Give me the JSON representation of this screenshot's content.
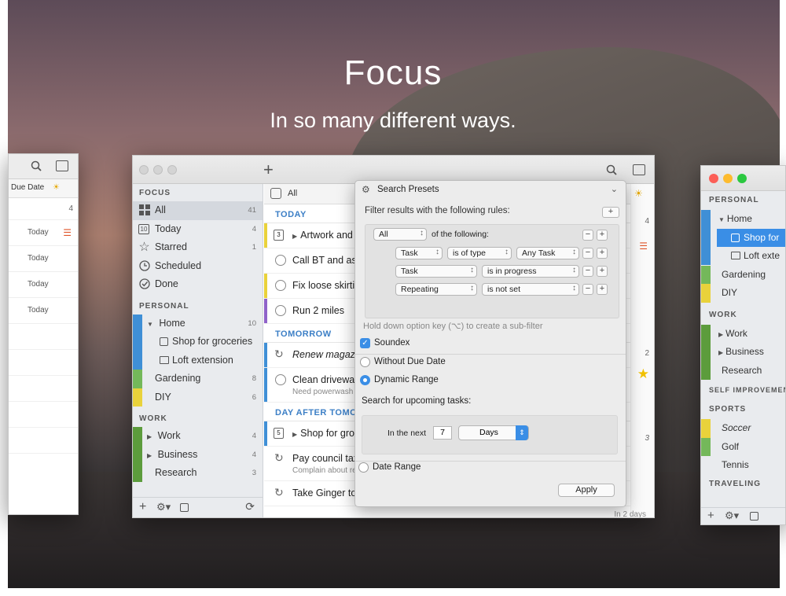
{
  "hero": {
    "title": "Focus",
    "subtitle": "In so many different ways."
  },
  "left_window": {
    "filter_label": "Due Date",
    "count": "4",
    "rows": [
      "Today",
      "Today",
      "Today",
      "Today"
    ]
  },
  "main_window": {
    "sidebar": {
      "focus_header": "Focus",
      "focus_items": [
        {
          "label": "All",
          "count": "41",
          "icon": "grid-icon"
        },
        {
          "label": "Today",
          "count": "4",
          "icon": "calendar-icon"
        },
        {
          "label": "Starred",
          "count": "1",
          "icon": "star-icon"
        },
        {
          "label": "Scheduled",
          "count": "",
          "icon": "clock-icon"
        },
        {
          "label": "Done",
          "count": "",
          "icon": "check-icon"
        }
      ],
      "personal_header": "Personal",
      "personal_items": [
        {
          "label": "Home",
          "count": "10"
        },
        {
          "label": "Shop for groceries",
          "count": ""
        },
        {
          "label": "Loft extension",
          "count": ""
        },
        {
          "label": "Gardening",
          "count": "8"
        },
        {
          "label": "DIY",
          "count": "6"
        }
      ],
      "work_header": "Work",
      "work_items": [
        {
          "label": "Work",
          "count": "4"
        },
        {
          "label": "Business",
          "count": "4"
        },
        {
          "label": "Research",
          "count": "3"
        }
      ]
    },
    "tasks": {
      "filter_label": "All",
      "today_header": "Today",
      "today_tasks": [
        "Artwork and",
        "Call BT and ask",
        "Fix loose skirtin",
        "Run 2 miles"
      ],
      "tomorrow_header": "Tomorrow",
      "tomorrow_tasks": [
        {
          "title": "Renew magazi",
          "note": ""
        },
        {
          "title": "Clean driveway",
          "note": "Need powerwash"
        }
      ],
      "day_after_header": "Day after tomo",
      "day_after_tasks": [
        {
          "title": "Shop for groc",
          "note": ""
        },
        {
          "title": "Pay council tax",
          "note": "Complain about re"
        },
        {
          "title": "Take Ginger to vet",
          "note": ""
        }
      ],
      "right_counts": [
        "4",
        "2",
        "3"
      ],
      "footer_due": "In 2 days"
    }
  },
  "search_presets": {
    "title": "Search Presets",
    "rules_label": "Filter results with the following rules:",
    "match_select": "All",
    "match_suffix": "of the following:",
    "rules": [
      {
        "field": "Task",
        "op": "is of type",
        "value": "Any Task"
      },
      {
        "field": "Task",
        "op": "is in progress",
        "value": ""
      },
      {
        "field": "Repeating",
        "op": "is not set",
        "value": ""
      }
    ],
    "hint": "Hold down option key (⌥) to create a sub-filter",
    "soundex_label": "Soundex",
    "soundex_checked": true,
    "without_due_label": "Without Due Date",
    "dynamic_range_label": "Dynamic Range",
    "upcoming_label": "Search for upcoming tasks:",
    "in_next_label": "In the next",
    "in_next_value": "7",
    "unit": "Days",
    "date_range_label": "Date Range",
    "apply_label": "Apply"
  },
  "right_window": {
    "personal_header": "Personal",
    "personal_items": [
      "Home",
      "Shop for",
      "Loft exte",
      "Gardening",
      "DIY"
    ],
    "work_header": "Work",
    "work_items": [
      "Work",
      "Business",
      "Research"
    ],
    "self_header": "Self Improvement",
    "sports_header": "Sports",
    "sports_items": [
      "Soccer",
      "Golf",
      "Tennis"
    ],
    "traveling_header": "Traveling"
  },
  "colors": {
    "accent_blue": "#3c7fc6",
    "home_blue": "#3f8fd6",
    "gardening_green": "#74b85a",
    "diy_yellow": "#e9d23b",
    "work_green": "#5c9c3c",
    "selection_blue": "#3a8ee6",
    "star_yellow": "#f2c200"
  }
}
